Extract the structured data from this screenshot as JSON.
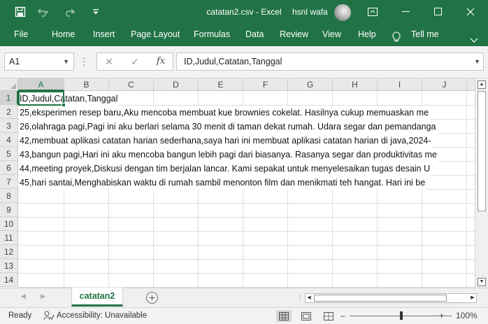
{
  "window": {
    "title": "catatan2.csv  -  Excel",
    "user_name": "hsnl wafa"
  },
  "ribbon": {
    "tabs": [
      "File",
      "Home",
      "Insert",
      "Page Layout",
      "Formulas",
      "Data",
      "Review",
      "View",
      "Help"
    ],
    "tell_me": "Tell me"
  },
  "formula_bar": {
    "name_box": "A1",
    "cancel_icon": "✕",
    "enter_icon": "✓",
    "fx_label": "fx",
    "content": "ID,Judul,Catatan,Tanggal"
  },
  "grid": {
    "columns": [
      "A",
      "B",
      "C",
      "D",
      "E",
      "F",
      "G",
      "H",
      "I",
      "J"
    ],
    "rows": [
      "1",
      "2",
      "3",
      "4",
      "5",
      "6",
      "7",
      "8",
      "9",
      "10",
      "11",
      "12",
      "13",
      "14"
    ],
    "selected_cell": "A1",
    "cells": [
      "ID,Judul,Catatan,Tanggal",
      "25,eksperimen resep baru,Aku mencoba membuat kue brownies cokelat. Hasilnya cukup memuaskan me",
      "26,olahraga pagi,Pagi ini aku berlari selama 30 menit di taman dekat rumah. Udara segar dan pemandanga",
      "42,membuat aplikasi catatan harian sederhana,saya hari ini membuat aplikasi catatan harian di java,2024-",
      "43,bangun pagi,Hari ini aku mencoba bangun lebih pagi dari biasanya. Rasanya segar dan produktivitas me",
      "44,meeting proyek,Diskusi dengan tim berjalan lancar. Kami sepakat untuk menyelesaikan tugas desain U",
      "45,hari santai,Menghabiskan waktu di rumah sambil menonton film dan menikmati teh hangat. Hari ini be"
    ]
  },
  "sheets": {
    "tabs": [
      "catatan2"
    ],
    "active": "catatan2",
    "add_label": "+"
  },
  "status": {
    "ready": "Ready",
    "accessibility": "Accessibility: Unavailable",
    "zoom": "100%",
    "zoom_minus": "–",
    "zoom_plus": "+"
  },
  "colors": {
    "accent": "#217346"
  }
}
